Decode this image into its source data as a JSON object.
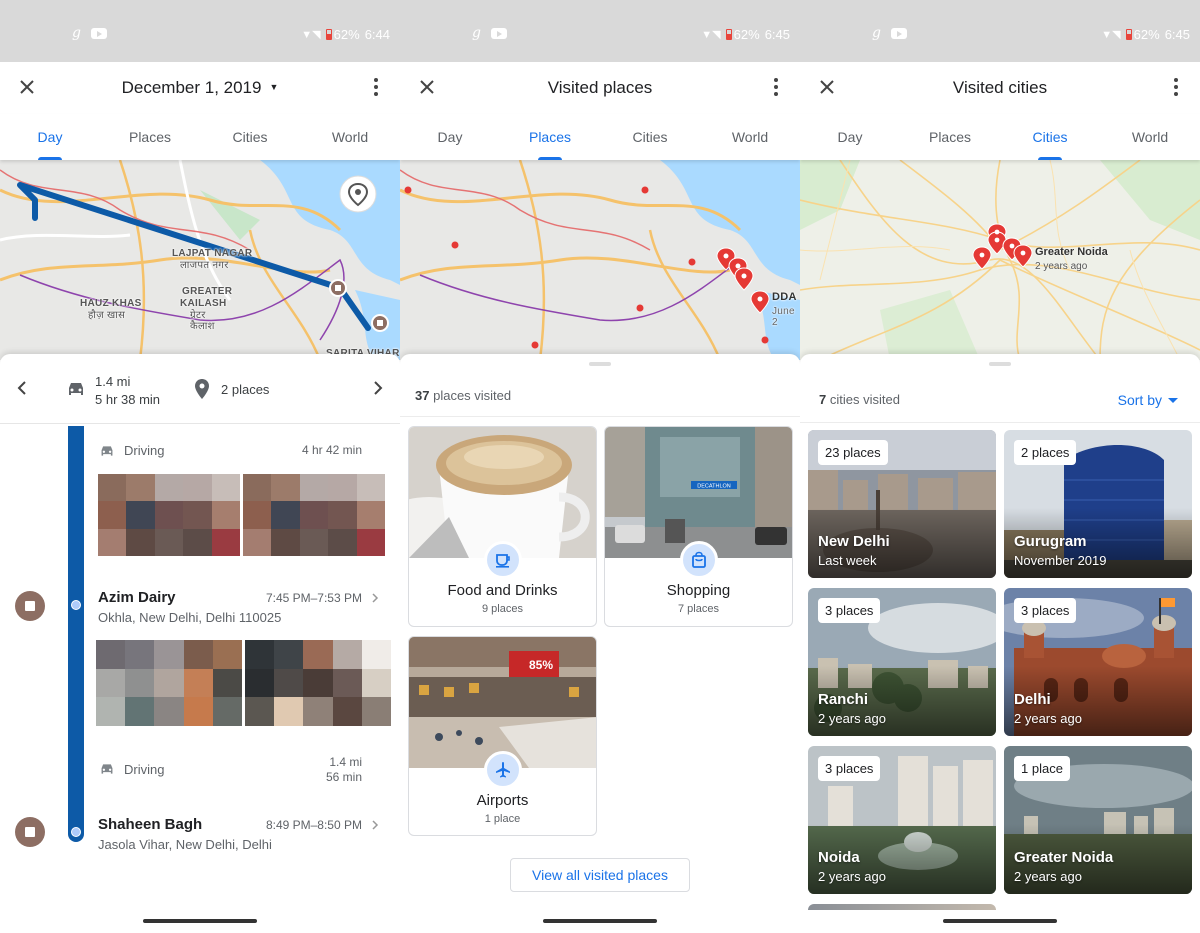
{
  "status": [
    {
      "battery": "62%",
      "time": "6:44"
    },
    {
      "battery": "62%",
      "time": "6:45"
    },
    {
      "battery": "62%",
      "time": "6:45"
    }
  ],
  "tabs": [
    "Day",
    "Places",
    "Cities",
    "World"
  ],
  "screen1": {
    "title": "December 1, 2019",
    "map_labels": {
      "lajpat": "LAJPAT NAGAR",
      "lajpat_hi": "लाजपत नगर",
      "hauz": "HAUZ KHAS",
      "hauz_hi": "हौज़ खास",
      "gk": "GREATER",
      "gk2": "KAILASH",
      "gk_hi": "ग्रेटर",
      "gk_hi2": "कैलाश",
      "sarita": "SARITA VIHAR"
    },
    "summary": {
      "distance": "1.4 mi",
      "duration": "5 hr 38 min",
      "places": "2 places"
    },
    "drive1": {
      "label": "Driving",
      "duration": "4 hr 42 min"
    },
    "stop1": {
      "name": "Azim Dairy",
      "time": "7:45 PM–7:53 PM",
      "address": "Okhla, New Delhi, Delhi 110025"
    },
    "drive2": {
      "label": "Driving",
      "distance": "1.4 mi",
      "duration": "56 min"
    },
    "stop2": {
      "name": "Shaheen Bagh",
      "time": "8:49 PM–8:50 PM",
      "address": "Jasola Vihar, New Delhi, Delhi"
    }
  },
  "screen2": {
    "title": "Visited places",
    "map_labels": {
      "dda": "DDA",
      "dda_sub": "June 2"
    },
    "count_num": "37",
    "count_text": "places visited",
    "categories": [
      {
        "title": "Food and Drinks",
        "sub": "9 places"
      },
      {
        "title": "Shopping",
        "sub": "7 places"
      },
      {
        "title": "Airports",
        "sub": "1 place"
      }
    ],
    "mall_sign": "DECATHLON",
    "airport_sign": "85%",
    "view_all": "View all visited places"
  },
  "screen3": {
    "title": "Visited cities",
    "pin_label": "Greater Noida",
    "pin_sub": "2 years ago",
    "count_num": "7",
    "count_text": "cities visited",
    "sort_label": "Sort by",
    "cities": [
      {
        "chip": "23 places",
        "name": "New Delhi",
        "when": "Last week"
      },
      {
        "chip": "2 places",
        "name": "Gurugram",
        "when": "November 2019"
      },
      {
        "chip": "3 places",
        "name": "Ranchi",
        "when": "2 years ago"
      },
      {
        "chip": "3 places",
        "name": "Delhi",
        "when": "2 years ago"
      },
      {
        "chip": "3 places",
        "name": "Noida",
        "when": "2 years ago"
      },
      {
        "chip": "1 place",
        "name": "Greater Noida",
        "when": "2 years ago"
      }
    ]
  },
  "colors": {
    "accent": "#1a73e8",
    "timeline": "#0d5aa7",
    "stop": "#8d6e63",
    "pin": "#e53935"
  }
}
